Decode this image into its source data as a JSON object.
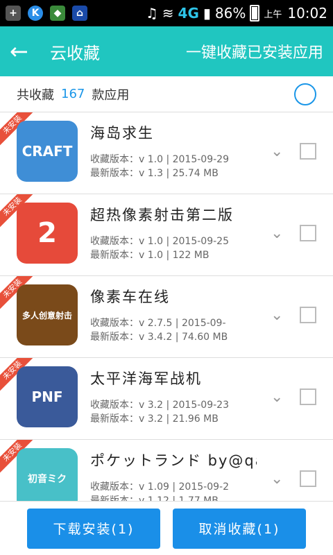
{
  "status": {
    "network": "4G",
    "battery": "86%",
    "ampm": "上午",
    "time": "10:02"
  },
  "appbar": {
    "back_icon": "back-arrow-icon",
    "title": "云收藏",
    "action": "一键收藏已安装应用"
  },
  "summary": {
    "prefix": "共收藏",
    "count": "167",
    "suffix": "款应用"
  },
  "ribbon_label": "未安装",
  "apps": [
    {
      "name": "海岛求生",
      "collected": "收藏版本：v 1.0 | 2015-09-29",
      "latest": "最新版本：v 1.3 | 25.74 MB",
      "icon_bg": "#3f8ed6",
      "icon_text": "CRAFT"
    },
    {
      "name": "超热像素射击第二版",
      "collected": "收藏版本：v 1.0 | 2015-09-25",
      "latest": "最新版本：v 1.0 | 122 MB",
      "icon_bg": "#e64a3a",
      "icon_text": "2"
    },
    {
      "name": "像素车在线",
      "collected": "收藏版本：v 2.7.5 | 2015-09-",
      "latest": "最新版本：v 3.4.2 | 74.60 MB",
      "icon_bg": "#7a4a1a",
      "icon_text": "多人创意射击"
    },
    {
      "name": "太平洋海军战机",
      "collected": "收藏版本：v 3.2 | 2015-09-23",
      "latest": "最新版本：v 3.2 | 21.96 MB",
      "icon_bg": "#3a5a9a",
      "icon_text": "PNF"
    },
    {
      "name": "ポケットランド by@qa...",
      "collected": "收藏版本：v 1.09 | 2015-09-2",
      "latest": "最新版本：v 1.12 | 1.77 MB",
      "icon_bg": "#48c0c8",
      "icon_text": "初音ミク"
    }
  ],
  "buttons": {
    "download": "下载安装(1)",
    "cancel": "取消收藏(1)"
  }
}
